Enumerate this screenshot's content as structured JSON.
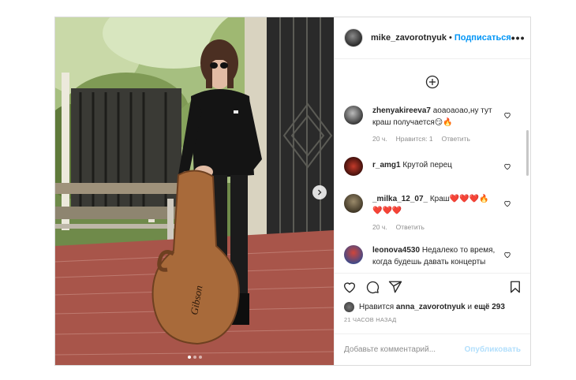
{
  "post": {
    "username": "mike_zavorotnyuk",
    "separator": "•",
    "follow_label": "Подписаться",
    "more_label": "•••",
    "photo_logo": "Gibson"
  },
  "comments": [
    {
      "username": "zhenyakireeva7",
      "text": "аоаоаоао,ну тут краш получается😏🔥",
      "time": "20 ч.",
      "likes": "Нравится: 1",
      "reply": "Ответить"
    },
    {
      "username": "r_amg1",
      "text": "Крутой перец",
      "time": "",
      "likes": "",
      "reply": ""
    },
    {
      "username": "_milka_12_07_",
      "text": "Краш❤️❤️❤️🔥❤️❤️❤️",
      "time": "20 ч.",
      "likes": "",
      "reply": "Ответить"
    },
    {
      "username": "leonova4530",
      "text": "Недалеко то время, когда будешь давать концерты",
      "time": "",
      "likes": "",
      "reply": ""
    }
  ],
  "likes": {
    "prefix": "Нравится",
    "user": "anna_zavorotnyuk",
    "middle": "и",
    "rest": "ещё 293"
  },
  "timeago": "21 ЧАСОВ НАЗАД",
  "add_comment": {
    "placeholder": "Добавьте комментарий...",
    "publish_label": "Опубликовать"
  },
  "icons": {
    "heart": "heart-icon",
    "comment": "comment-icon",
    "share": "share-icon",
    "save": "bookmark-icon",
    "add": "plus-circle-icon",
    "next": "chevron-right-icon"
  },
  "colors": {
    "accent": "#0095f6",
    "muted": "#8e8e8e",
    "publish_disabled": "#b2dffc"
  }
}
